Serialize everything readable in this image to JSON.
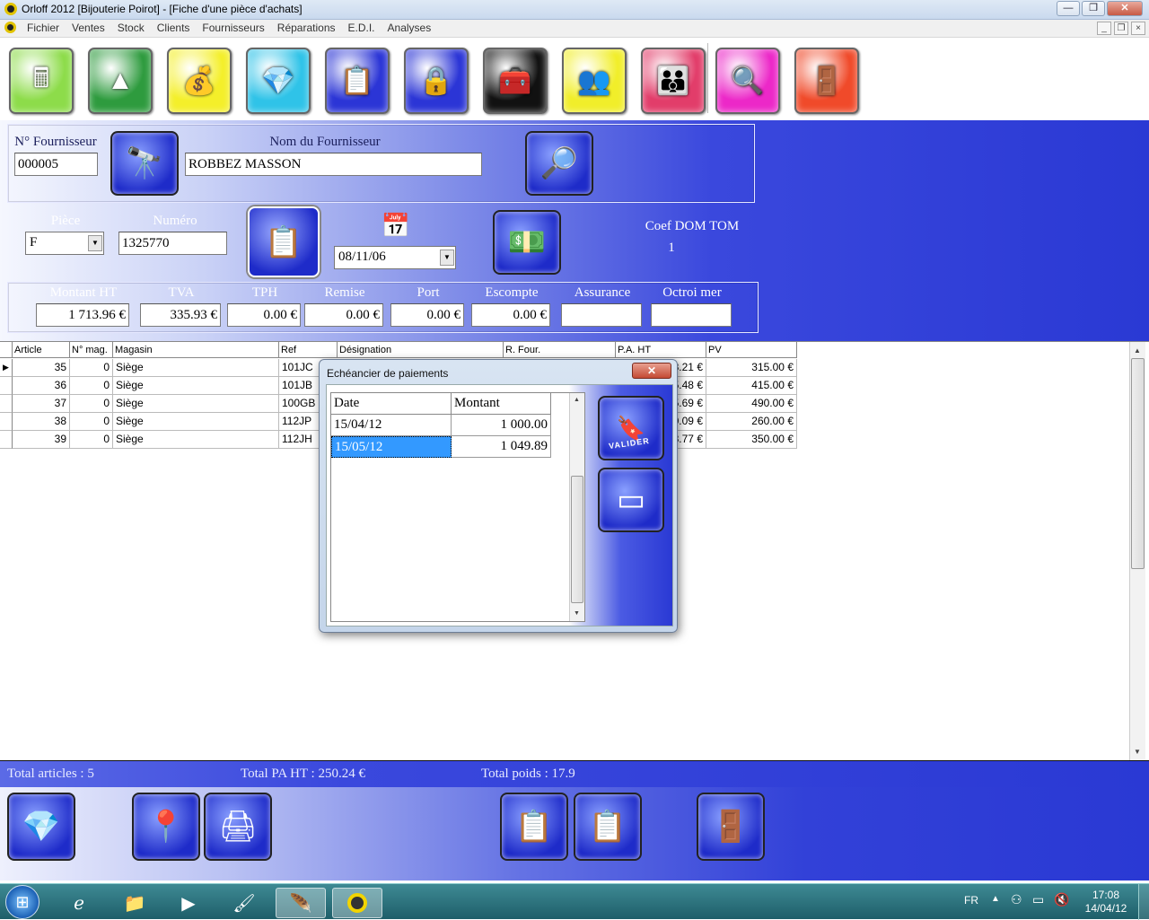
{
  "window": {
    "title": "Orloff 2012 [Bijouterie Poirot] - [Fiche d'une pièce d'achats]",
    "minimize": "—",
    "maximize": "❐",
    "close": "✕"
  },
  "menu": [
    "Fichier",
    "Ventes",
    "Stock",
    "Clients",
    "Fournisseurs",
    "Réparations",
    "E.D.I.",
    "Analyses"
  ],
  "mdi": {
    "min": "_",
    "restore": "❐",
    "close": "×"
  },
  "toolbar_icons": [
    {
      "name": "cash-register-icon",
      "glyph": "🖩",
      "bg": "#8ddc4a"
    },
    {
      "name": "prism-icon",
      "glyph": "▲",
      "bg": "#2e9b3e"
    },
    {
      "name": "gold-jewels-icon",
      "glyph": "💰",
      "bg": "#f4ef2a"
    },
    {
      "name": "diamond-icon",
      "glyph": "💎",
      "bg": "#2fc3e8"
    },
    {
      "name": "clipboard-icon",
      "glyph": "📋",
      "bg": "#2b35d6"
    },
    {
      "name": "safe-icon",
      "glyph": "🔒",
      "bg": "#2b35d6"
    },
    {
      "name": "toolbox-icon",
      "glyph": "🧰",
      "bg": "#111"
    },
    {
      "name": "suppliers-icon",
      "glyph": "👥",
      "bg": "#f1ee2a"
    },
    {
      "name": "customers-icon",
      "glyph": "👪",
      "bg": "#e23d6a"
    },
    {
      "name": "analysis-icon",
      "glyph": "🔍",
      "bg": "#ec28c8"
    },
    {
      "name": "exit-door-icon",
      "glyph": "🚪",
      "bg": "#f04a2a"
    }
  ],
  "supplier": {
    "num_label": "N° Fournisseur",
    "num_value": "000005",
    "name_label": "Nom du Fournisseur",
    "name_value": "ROBBEZ MASSON"
  },
  "piece": {
    "piece_label": "Pièce",
    "piece_value": "F",
    "numero_label": "Numéro",
    "numero_value": "1325770",
    "date_value": "08/11/06",
    "coef_label": "Coef DOM TOM",
    "coef_value": "1"
  },
  "totals": {
    "labels": [
      "Montant HT",
      "TVA",
      "TPH",
      "Remise",
      "Port",
      "Escompte",
      "Assurance",
      "Octroi mer"
    ],
    "values": [
      "1 713.96 €",
      "335.93 €",
      "0.00 €",
      "0.00 €",
      "0.00 €",
      "0.00 €",
      "",
      ""
    ]
  },
  "grid": {
    "headers": [
      "Article",
      "N° mag.",
      "Magasin",
      "Ref",
      "Désignation",
      "R. Four.",
      "P.A. HT",
      "PV"
    ],
    "rows": [
      {
        "article": "35",
        "nmag": "0",
        "magasin": "Siège",
        "ref": "101JC",
        "pa": "3.21 €",
        "pv": "315.00 €"
      },
      {
        "article": "36",
        "nmag": "0",
        "magasin": "Siège",
        "ref": "101JB",
        "pa": "5.48 €",
        "pv": "415.00 €"
      },
      {
        "article": "37",
        "nmag": "0",
        "magasin": "Siège",
        "ref": "100GB",
        "pa": "5.69 €",
        "pv": "490.00 €"
      },
      {
        "article": "38",
        "nmag": "0",
        "magasin": "Siège",
        "ref": "112JP",
        "pa": "0.09 €",
        "pv": "260.00 €"
      },
      {
        "article": "39",
        "nmag": "0",
        "magasin": "Siège",
        "ref": "112JH",
        "pa": "3.77 €",
        "pv": "350.00 €"
      }
    ]
  },
  "footer": {
    "articles": "Total articles :   5",
    "pa": "Total PA HT : 250.24 €",
    "poids": "Total poids : 17.9"
  },
  "dialog": {
    "title": "Echéancier de paiements",
    "close": "✕",
    "headers": [
      "Date",
      "Montant"
    ],
    "rows": [
      {
        "date": "15/04/12",
        "montant": "1 000.00"
      },
      {
        "date": "15/05/12",
        "montant": "1 049.89"
      }
    ],
    "validate_label": "VALIDER"
  },
  "taskbar": {
    "lang": "FR",
    "time": "17:08",
    "date": "14/04/12"
  }
}
